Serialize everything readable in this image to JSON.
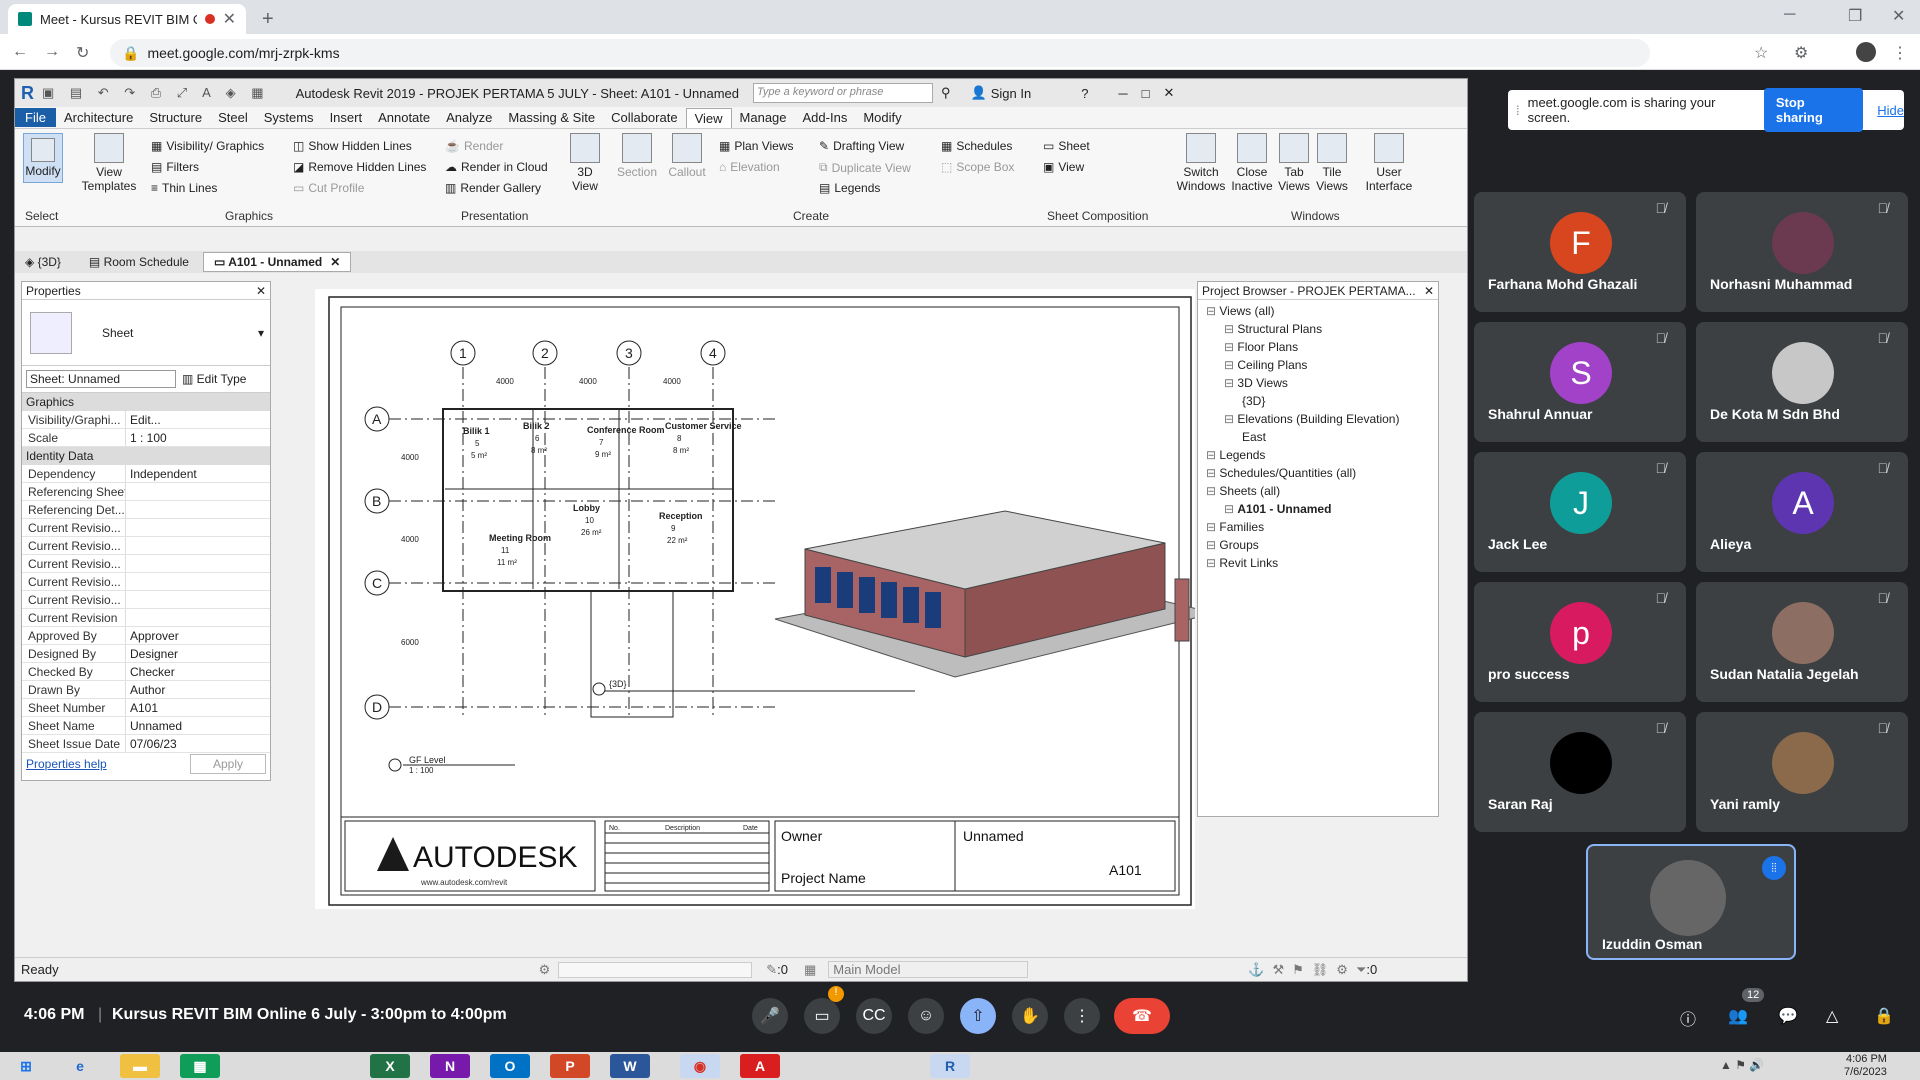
{
  "browser": {
    "tab_title": "Meet - Kursus REVIT BIM On...",
    "url": "meet.google.com/mrj-zrpk-kms"
  },
  "revit": {
    "title": "Autodesk Revit 2019 - PROJEK PERTAMA 5 JULY - Sheet: A101 - Unnamed",
    "search_placeholder": "Type a keyword or phrase",
    "sign_in": "Sign In",
    "menu": [
      "File",
      "Architecture",
      "Structure",
      "Steel",
      "Systems",
      "Insert",
      "Annotate",
      "Analyze",
      "Massing & Site",
      "Collaborate",
      "View",
      "Manage",
      "Add-Ins",
      "Modify"
    ],
    "ribbon": {
      "modify": "Modify",
      "select": "Select",
      "view_templates": "View Templates",
      "vis_graphics": "Visibility/ Graphics",
      "filters": "Filters",
      "thin_lines": "Thin Lines",
      "show_hidden": "Show Hidden Lines",
      "remove_hidden": "Remove Hidden Lines",
      "cut_profile": "Cut Profile",
      "render": "Render",
      "render_cloud": "Render in Cloud",
      "render_gallery": "Render Gallery",
      "view_3d": "3D View",
      "section": "Section",
      "callout": "Callout",
      "plan_views": "Plan Views",
      "elevation": "Elevation",
      "drafting_view": "Drafting View",
      "duplicate_view": "Duplicate View",
      "legends": "Legends",
      "schedules": "Schedules",
      "scope_box": "Scope Box",
      "sheet": "Sheet",
      "view": "View",
      "switch_windows": "Switch Windows",
      "close_inactive": "Close Inactive",
      "tab_views": "Tab Views",
      "tile_views": "Tile Views",
      "user_interface": "User Interface",
      "p_graphics": "Graphics",
      "p_presentation": "Presentation",
      "p_create": "Create",
      "p_sheet": "Sheet Composition",
      "p_windows": "Windows"
    },
    "doc_tabs": [
      "{3D}",
      "Room Schedule",
      "A101 - Unnamed"
    ],
    "properties": {
      "title": "Properties",
      "type": "Sheet",
      "selector": "Sheet: Unnamed",
      "edit_type": "Edit Type",
      "graphics": "Graphics",
      "identity": "Identity Data",
      "help": "Properties help",
      "apply": "Apply",
      "rows": [
        [
          "Visibility/Graphi...",
          "Edit..."
        ],
        [
          "Scale",
          "1 : 100"
        ]
      ],
      "id_rows": [
        [
          "Dependency",
          "Independent"
        ],
        [
          "Referencing Sheet",
          ""
        ],
        [
          "Referencing Det...",
          ""
        ],
        [
          "Current Revisio...",
          ""
        ],
        [
          "Current Revisio...",
          ""
        ],
        [
          "Current Revisio...",
          ""
        ],
        [
          "Current Revisio...",
          ""
        ],
        [
          "Current Revisio...",
          ""
        ],
        [
          "Current Revision",
          ""
        ],
        [
          "Approved By",
          "Approver"
        ],
        [
          "Designed By",
          "Designer"
        ],
        [
          "Checked By",
          "Checker"
        ],
        [
          "Drawn By",
          "Author"
        ],
        [
          "Sheet Number",
          "A101"
        ],
        [
          "Sheet Name",
          "Unnamed"
        ],
        [
          "Sheet Issue Date",
          "07/06/23"
        ]
      ]
    },
    "sheet": {
      "grids": [
        "1",
        "2",
        "3",
        "4"
      ],
      "rows": [
        "A",
        "B",
        "C",
        "D"
      ],
      "dim": "4000",
      "dimv": [
        "4000",
        "4000",
        "6000"
      ],
      "rooms": [
        [
          "Bilik 1",
          "5",
          "5 m²"
        ],
        [
          "Bilik 2",
          "6",
          "8 m²"
        ],
        [
          "Conference Room",
          "7",
          "9 m²"
        ],
        [
          "Customer Service",
          "8",
          "8 m²"
        ],
        [
          "Meeting Room",
          "11",
          "11 m²"
        ],
        [
          "Lobby",
          "10",
          "26 m²"
        ],
        [
          "Reception",
          "9",
          "22 m²"
        ]
      ],
      "view1": "GF Level",
      "view1_scale": "1 : 100",
      "view2": "{3D}",
      "logo": "AUTODESK",
      "logo_url": "www.autodesk.com/revit",
      "rev_cols": [
        "No.",
        "Description",
        "Date"
      ],
      "owner": "Owner",
      "project": "Project Name",
      "name": "Unnamed",
      "number": "A101"
    },
    "browser": {
      "title": "Project Browser - PROJEK PERTAMA...",
      "items": [
        "Views (all)",
        "Structural Plans",
        "Floor Plans",
        "Ceiling Plans",
        "3D Views",
        "{3D}",
        "Elevations (Building Elevation)",
        "East",
        "Legends",
        "Schedules/Quantities (all)",
        "Sheets (all)",
        "A101 - Unnamed",
        "Families",
        "Groups",
        "Revit Links"
      ]
    },
    "status": {
      "ready": "Ready",
      "zero": ":0",
      "model": "Main Model",
      "filter": ":0"
    }
  },
  "meet": {
    "sharing": "meet.google.com is sharing your screen.",
    "stop": "Stop sharing",
    "hide": "Hide",
    "participants": [
      {
        "name": "Farhana Mohd Ghazali",
        "initial": "F",
        "color": "#d8461f"
      },
      {
        "name": "Norhasni Muhammad",
        "initial": "",
        "color": "#6b3a50"
      },
      {
        "name": "Shahrul Annuar",
        "initial": "S",
        "color": "#a142c9"
      },
      {
        "name": "De Kota M Sdn Bhd",
        "initial": "",
        "color": "#c7c7c7"
      },
      {
        "name": "Jack Lee",
        "initial": "J",
        "color": "#0f9d9a"
      },
      {
        "name": "Alieya",
        "initial": "A",
        "color": "#5e35b1"
      },
      {
        "name": "pro success",
        "initial": "p",
        "color": "#d81b60"
      },
      {
        "name": "Sudan Natalia Jegelah",
        "initial": "",
        "color": "#8d6e63"
      },
      {
        "name": "Saran Raj",
        "initial": "",
        "color": "#000000"
      },
      {
        "name": "Yani ramly",
        "initial": "",
        "color": "#8a6a4a"
      }
    ],
    "self": {
      "name": "Izuddin Osman"
    },
    "time": "4:06 PM",
    "meeting": "Kursus REVIT BIM Online 6 July - 3:00pm to 4:00pm",
    "people_count": "12"
  },
  "taskbar": {
    "time": "4:06 PM",
    "date": "7/6/2023"
  }
}
